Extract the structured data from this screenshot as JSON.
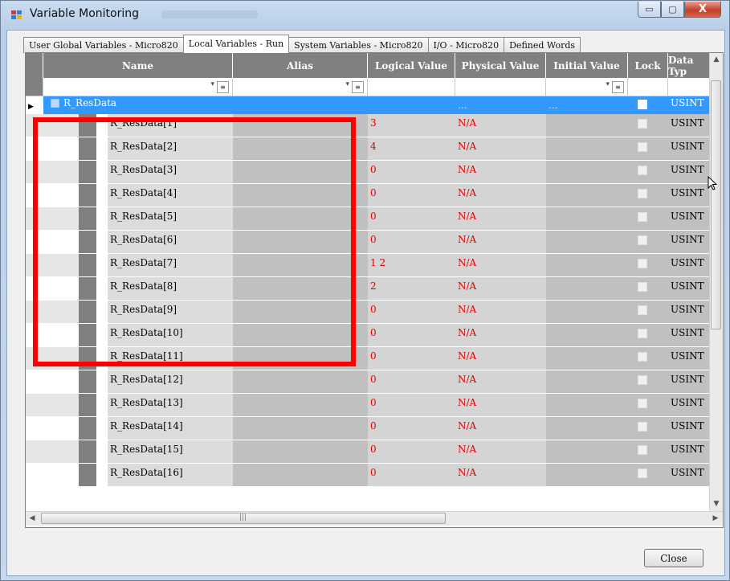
{
  "window": {
    "title": "Variable Monitoring",
    "controls": {
      "minimize": "▭",
      "maximize": "▢",
      "close": "X"
    }
  },
  "tabs": [
    "User Global Variables - Micro820",
    "Local Variables - Run",
    "System Variables - Micro820",
    "I/O - Micro820",
    "Defined Words"
  ],
  "active_tab": "Local Variables - Run",
  "columns": [
    "Name",
    "Alias",
    "Logical Value",
    "Physical Value",
    "Initial Value",
    "Lock",
    "Data Typ"
  ],
  "parent_row": {
    "name": "R_ResData",
    "logical": "",
    "physical": "...",
    "initial": "...",
    "type": "USINT"
  },
  "rows": [
    {
      "name": "R_ResData[1]",
      "logical": "3",
      "physical": "N/A",
      "type": "USINT"
    },
    {
      "name": "R_ResData[2]",
      "logical": "4",
      "physical": "N/A",
      "type": "USINT"
    },
    {
      "name": "R_ResData[3]",
      "logical": "0",
      "physical": "N/A",
      "type": "USINT"
    },
    {
      "name": "R_ResData[4]",
      "logical": "0",
      "physical": "N/A",
      "type": "USINT"
    },
    {
      "name": "R_ResData[5]",
      "logical": "0",
      "physical": "N/A",
      "type": "USINT"
    },
    {
      "name": "R_ResData[6]",
      "logical": "0",
      "physical": "N/A",
      "type": "USINT"
    },
    {
      "name": "R_ResData[7]",
      "logical": "1 2",
      "physical": "N/A",
      "type": "USINT"
    },
    {
      "name": "R_ResData[8]",
      "logical": "2",
      "physical": "N/A",
      "type": "USINT"
    },
    {
      "name": "R_ResData[9]",
      "logical": "0",
      "physical": "N/A",
      "type": "USINT"
    },
    {
      "name": "R_ResData[10]",
      "logical": "0",
      "physical": "N/A",
      "type": "USINT"
    },
    {
      "name": "R_ResData[11]",
      "logical": "0",
      "physical": "N/A",
      "type": "USINT"
    },
    {
      "name": "R_ResData[12]",
      "logical": "0",
      "physical": "N/A",
      "type": "USINT"
    },
    {
      "name": "R_ResData[13]",
      "logical": "0",
      "physical": "N/A",
      "type": "USINT"
    },
    {
      "name": "R_ResData[14]",
      "logical": "0",
      "physical": "N/A",
      "type": "USINT"
    },
    {
      "name": "R_ResData[15]",
      "logical": "0",
      "physical": "N/A",
      "type": "USINT"
    },
    {
      "name": "R_ResData[16]",
      "logical": "0",
      "physical": "N/A",
      "type": "USINT"
    }
  ],
  "buttons": {
    "close": "Close"
  },
  "colors": {
    "selection": "#3399ff",
    "highlight_box": "#ff0000",
    "value_text": "#e00000",
    "header_bg": "#808080"
  }
}
